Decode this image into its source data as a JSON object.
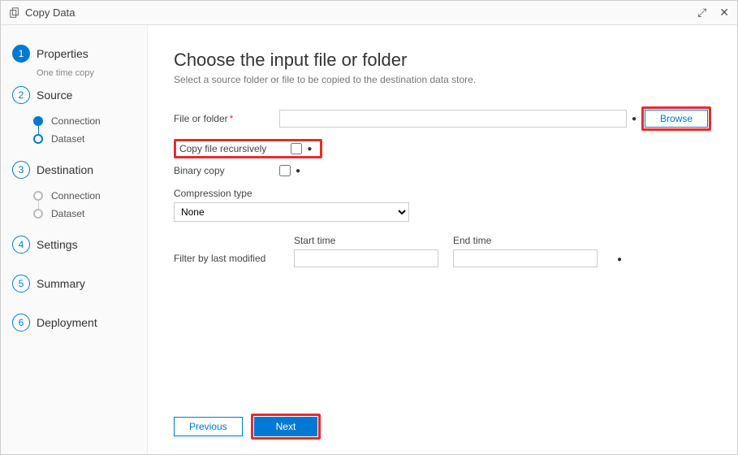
{
  "header": {
    "title": "Copy Data"
  },
  "sidebar": {
    "steps": [
      {
        "num": "1",
        "label": "Properties",
        "sub": "One time copy"
      },
      {
        "num": "2",
        "label": "Source",
        "substeps": [
          "Connection",
          "Dataset"
        ],
        "active": "Connection"
      },
      {
        "num": "3",
        "label": "Destination",
        "substeps": [
          "Connection",
          "Dataset"
        ]
      },
      {
        "num": "4",
        "label": "Settings"
      },
      {
        "num": "5",
        "label": "Summary"
      },
      {
        "num": "6",
        "label": "Deployment"
      }
    ]
  },
  "main": {
    "title": "Choose the input file or folder",
    "desc": "Select a source folder or file to be copied to the destination data store.",
    "file_label": "File or folder",
    "file_value": "",
    "browse": "Browse",
    "copy_recursive": "Copy file recursively",
    "binary_copy": "Binary copy",
    "compression_label": "Compression type",
    "compression_value": "None",
    "filter_label": "Filter by last modified",
    "start_label": "Start time",
    "start_value": "",
    "end_label": "End time",
    "end_value": ""
  },
  "footer": {
    "previous": "Previous",
    "next": "Next"
  }
}
